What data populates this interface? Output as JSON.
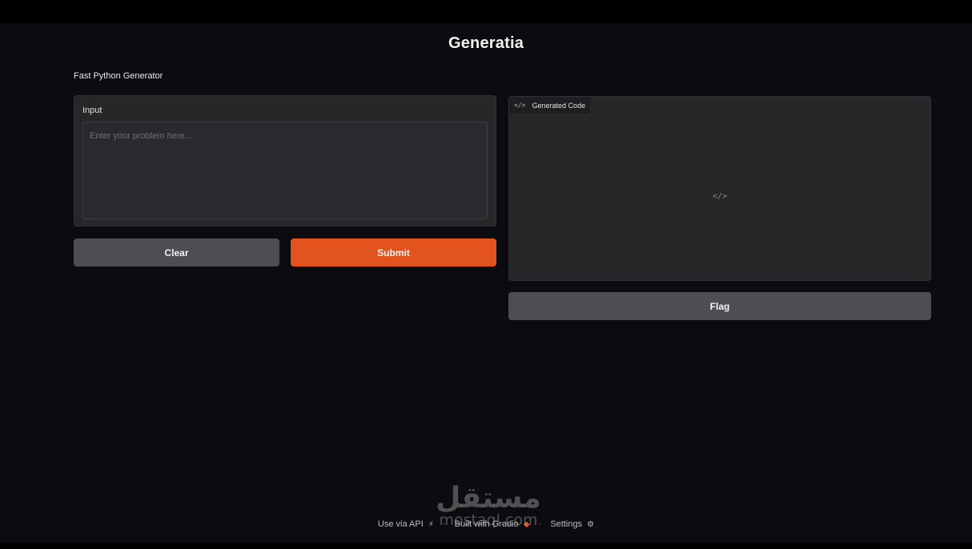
{
  "app": {
    "title": "Generatia",
    "description": "Fast Python Generator"
  },
  "input": {
    "label": "Input",
    "placeholder": "Enter your problem here...",
    "value": ""
  },
  "buttons": {
    "clear": "Clear",
    "submit": "Submit",
    "flag": "Flag"
  },
  "output": {
    "label": "Generated Code",
    "tab_icon": "</>",
    "placeholder_icon": "</>"
  },
  "footer": {
    "api": "Use via API",
    "built": "Built with Gradio",
    "settings": "Settings",
    "separator": "·"
  },
  "watermark": {
    "arabic": "مستقل",
    "latin": "mostaql.com"
  },
  "colors": {
    "background": "#0c0c10",
    "panel": "#27272a",
    "accent": "#e2531d",
    "secondary_button": "#4d4d53"
  },
  "icons": {
    "api": "rocket-icon",
    "gradio": "gradio-logo-icon",
    "settings": "gear-icon",
    "code": "code-brackets-icon"
  }
}
